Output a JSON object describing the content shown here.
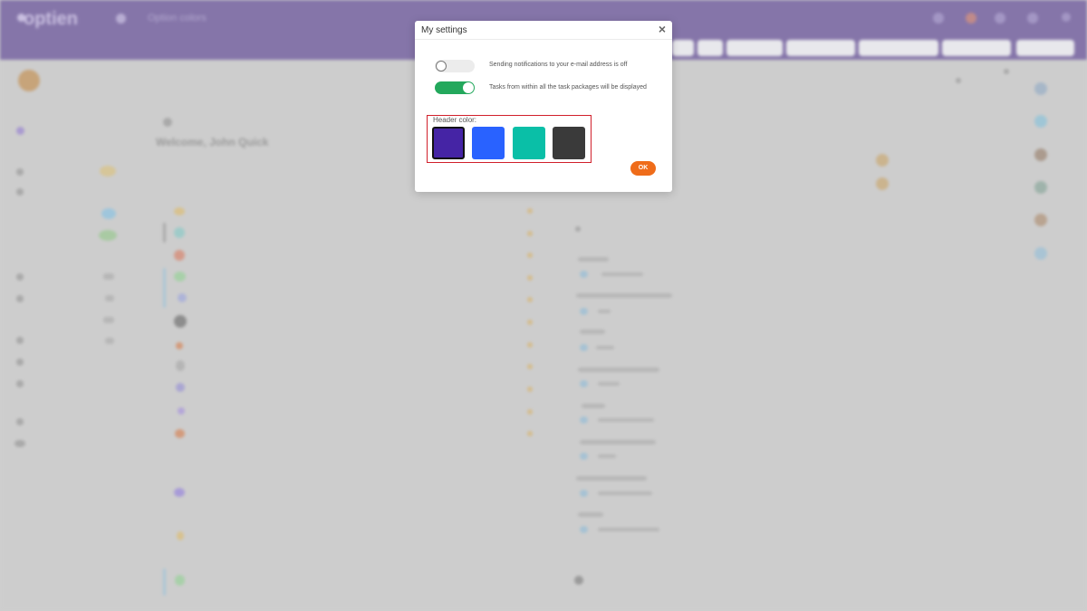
{
  "background": {
    "logo_text": "optien",
    "app_subtitle": "Option colors",
    "welcome_text": "Welcome, John Quick",
    "header_color": "#8575a9"
  },
  "modal": {
    "title": "My settings",
    "close_icon": "×",
    "settings": [
      {
        "label": "Sending notifications to your e-mail address is off",
        "enabled": false
      },
      {
        "label": "Tasks from within all the task packages will be displayed",
        "enabled": true
      }
    ],
    "header_color_label": "Header color:",
    "swatches": [
      {
        "name": "purple",
        "color": "#4524a5",
        "selected": true
      },
      {
        "name": "blue",
        "color": "#2962ff",
        "selected": false
      },
      {
        "name": "teal",
        "color": "#0abfa7",
        "selected": false
      },
      {
        "name": "dark-gray",
        "color": "#3a3a3a",
        "selected": false
      }
    ],
    "ok_label": "OK"
  }
}
